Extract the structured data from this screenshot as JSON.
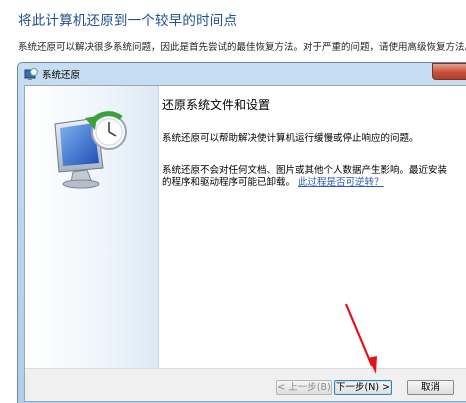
{
  "page": {
    "heading": "将此计算机还原到一个较早的时间点",
    "description": "系统还原可以解决很多系统问题，因此是首先尝试的最佳恢复方法。对于严重的问题，请使用高级恢复方法。"
  },
  "window": {
    "title": "系统还原",
    "content": {
      "heading": "还原系统文件和设置",
      "paragraph1": "系统还原可以帮助解决使计算机运行缓慢或停止响应的问题。",
      "paragraph2": "系统还原不会对任何文档、图片或其他个人数据产生影响。最近安装的程序和驱动程序可能已卸载。",
      "link": "此过程是否可逆转？"
    },
    "buttons": {
      "back": "< 上一步(B)",
      "next": "下一步(N) >",
      "cancel": "取消"
    }
  },
  "colors": {
    "heading": "#1f4f8f",
    "link": "#2a57c4",
    "annotation_arrow": "#e4101c",
    "close_button": "#c8503a"
  }
}
